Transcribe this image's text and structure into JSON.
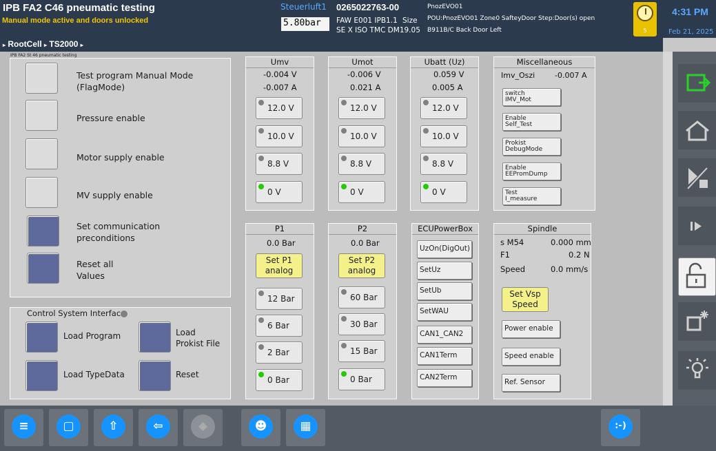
{
  "header": {
    "title": "IPB FA2 C46 pneumatic testing",
    "status": "Manual mode active and doors unlocked",
    "air_label": "Steuerluft1",
    "air_value": "5.80bar",
    "serial": "0265022763-00",
    "faw": "FAW E001 IPB1.1",
    "size_label": "Size",
    "se_line": "SE X ISO  TMC DM19.05",
    "pnoz": "PnozEVO01",
    "pou": "POU:PnozEVO01 Zone0 SafteyDoor Step:Door(s) open",
    "door": "B911B/C Back Door Left",
    "alarm_count": "5",
    "time": "4:31 PM",
    "date": "Feb 21, 2025"
  },
  "breadcrumb": {
    "item1": "RootCell",
    "item2": "TS2000"
  },
  "left_panel": {
    "caption": "IPB FA2 St 46 pneumatic testing",
    "rows": [
      {
        "label1": "Test program Manual Mode",
        "label2": "(FlagMode)"
      },
      {
        "label1": "Pressure enable",
        "label2": ""
      },
      {
        "label1": "Motor supply enable",
        "label2": ""
      },
      {
        "label1": "MV supply enable",
        "label2": ""
      },
      {
        "label1": "Set communication",
        "label2": "preconditions"
      },
      {
        "label1": "Reset all",
        "label2": "Values"
      }
    ]
  },
  "csi": {
    "title": "Control System Interface",
    "load_program": "Load Program",
    "load_prokist1": "Load",
    "load_prokist2": "Prokist File",
    "load_typedata": "Load TypeData",
    "reset": "Reset"
  },
  "umv": {
    "title": "Umv",
    "v": "-0.004 V",
    "a": "-0.007 A",
    "b1": "12.0 V",
    "b2": "10.0 V",
    "b3": "8.8 V",
    "b4": "0 V"
  },
  "umot": {
    "title": "Umot",
    "v": "-0.006 V",
    "a": "0.021 A",
    "b1": "12.0 V",
    "b2": "10.0 V",
    "b3": "8.8 V",
    "b4": "0 V"
  },
  "ubatt": {
    "title": "Ubatt (Uz)",
    "v": "0.059 V",
    "a": "0.005 A",
    "b1": "12.0 V",
    "b2": "10.0 V",
    "b3": "8.8 V",
    "b4": "0 V"
  },
  "misc": {
    "title": "Miscellaneous",
    "osz_label": "Imv_Oszi",
    "osz_val": "-0.007 A",
    "b1a": "switch",
    "b1b": "IMV_Mot",
    "b2a": "Enable",
    "b2b": "Self_Test",
    "b3a": "Prokist",
    "b3b": "DebugMode",
    "b4a": "Enable",
    "b4b": "EEPromDump",
    "b5a": "Test",
    "b5b": "I_measure"
  },
  "p1": {
    "title": "P1",
    "val": "0.0 Bar",
    "set1": "Set P1",
    "set2": "analog",
    "b1": "12 Bar",
    "b2": "6 Bar",
    "b3": "2 Bar",
    "b4": "0 Bar"
  },
  "p2": {
    "title": "P2",
    "val": "0.0 Bar",
    "set1": "Set P2",
    "set2": "analog",
    "b1": "60 Bar",
    "b2": "30 Bar",
    "b3": "15 Bar",
    "b4": "0 Bar"
  },
  "ecu": {
    "title": "ECUPowerBox",
    "b1": "UzOn(DigOut)",
    "b2": "SetUz",
    "b3": "SetUb",
    "b4": "SetWAU",
    "b5": "CAN1_CAN2",
    "b6": "CAN1Term",
    "b7": "CAN2Term"
  },
  "spindle": {
    "title": "Spindle",
    "sm_label": "s M54",
    "sm_val": "0.000 mm",
    "f_label": "F1",
    "f_val": "0.2 N",
    "sp_label": "Speed",
    "sp_val": "0.0 mm/s",
    "vsp1": "Set Vsp",
    "vsp2": "Speed",
    "b1": "Power enable",
    "b2": "Speed enable",
    "b3": "Ref. Sensor"
  },
  "footer": {
    "status_btn": ":-)"
  },
  "colors": {
    "accent": "#1793ff",
    "status_yellow": "#f2c400",
    "led_on": "#22cc00",
    "title_bar": "#2b3a4c"
  }
}
